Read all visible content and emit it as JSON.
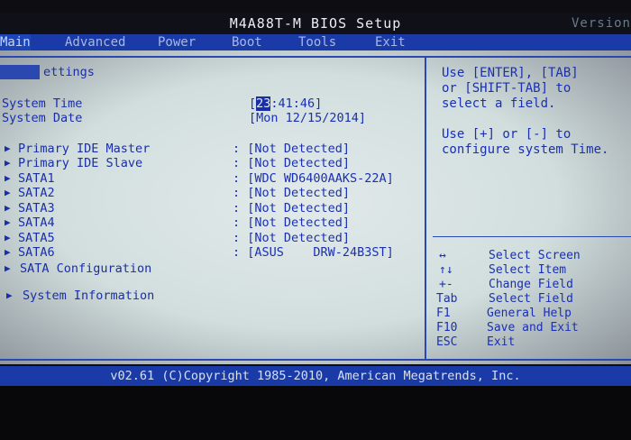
{
  "title": "M4A88T-M BIOS Setup",
  "version": "Version",
  "menu": [
    "Main",
    "Advanced",
    "Power",
    "Boot",
    "Tools",
    "Exit"
  ],
  "section_title": "ettings",
  "system_time": {
    "label": "System Time",
    "open": "[",
    "hour": "23",
    "rest": ":41:46]"
  },
  "system_date": {
    "label": "System Date",
    "value": "[Mon 12/15/2014]"
  },
  "devices": [
    {
      "label": "Primary IDE Master",
      "value": ": [Not Detected]"
    },
    {
      "label": "Primary IDE Slave",
      "value": ": [Not Detected]"
    },
    {
      "label": "SATA1",
      "value": ": [WDC WD6400AAKS-22A]"
    },
    {
      "label": "SATA2",
      "value": ": [Not Detected]"
    },
    {
      "label": "SATA3",
      "value": ": [Not Detected]"
    },
    {
      "label": "SATA4",
      "value": ": [Not Detected]"
    },
    {
      "label": "SATA5",
      "value": ": [Not Detected]"
    },
    {
      "label": "SATA6",
      "value": ": [ASUS    DRW-24B3ST]"
    }
  ],
  "submenus": [
    "SATA Configuration",
    "System Information"
  ],
  "help_lines": [
    "Use [ENTER], [TAB]",
    "or [SHIFT-TAB] to",
    "select a field.",
    "",
    "Use [+] or [-] to",
    "configure system Time."
  ],
  "keys": [
    {
      "key": "↔",
      "desc": "Select Screen"
    },
    {
      "key": "↑↓",
      "desc": "Select Item"
    },
    {
      "key": "+-",
      "desc": "Change Field"
    },
    {
      "key": "Tab",
      "desc": "Select Field"
    },
    {
      "key": "F1",
      "desc": "General Help"
    },
    {
      "key": "F10",
      "desc": "Save and Exit"
    },
    {
      "key": "ESC",
      "desc": "Exit"
    }
  ],
  "footer": "v02.61 (C)Copyright 1985-2010, American Megatrends, Inc.",
  "colors": {
    "panel": "#d2dede",
    "accent_blue": "#1a3aa8",
    "text_blue": "#1a2ea8"
  }
}
